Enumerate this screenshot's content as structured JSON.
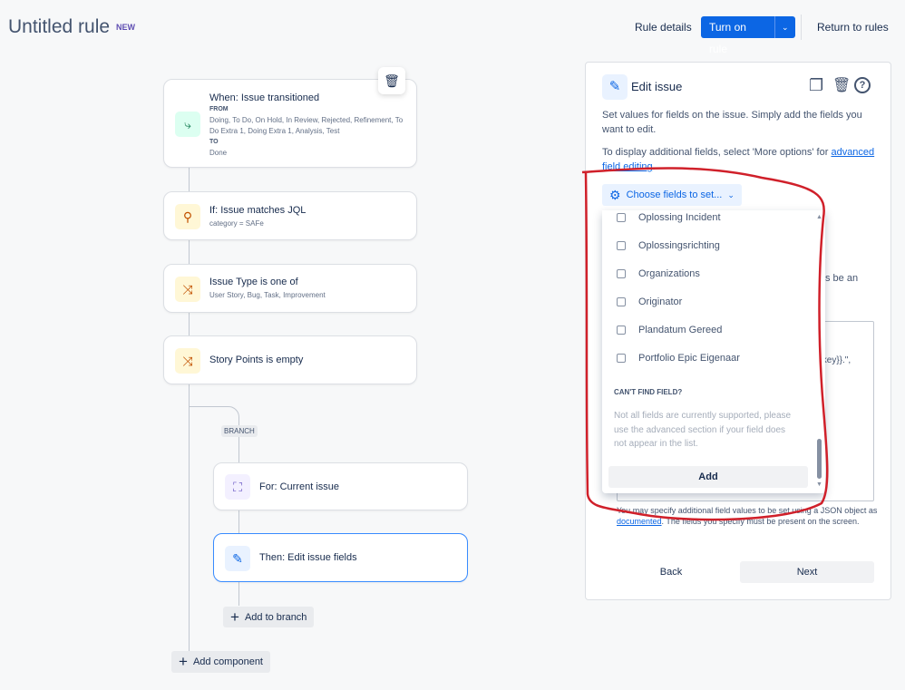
{
  "header": {
    "title": "Untitled rule",
    "badge": "NEW",
    "rule_details": "Rule details",
    "turn_on": "Turn on rule",
    "return": "Return to rules"
  },
  "flow": {
    "trigger": {
      "title": "When: Issue transitioned",
      "from_label": "FROM",
      "from": "Doing, To Do, On Hold, In Review, Rejected, Refinement, To Do Extra 1, Doing Extra 1, Analysis, Test",
      "to_label": "TO",
      "to": "Done"
    },
    "condition1": {
      "title": "If: Issue matches JQL",
      "sub": "category = SAFe"
    },
    "condition2": {
      "title": "Issue Type is one of",
      "sub": "User Story, Bug, Task, Improvement"
    },
    "condition3": {
      "title": "Story Points is empty"
    },
    "branch_label": "BRANCH",
    "branch": {
      "title": "For: Current issue"
    },
    "action": {
      "title": "Then: Edit issue fields"
    },
    "add_to_branch": "Add to branch",
    "add_component": "Add component"
  },
  "panel": {
    "title": "Edit issue",
    "desc1": "Set values for fields on the issue. Simply add the fields you want to edit.",
    "desc2": "To display additional fields, select 'More options' for ",
    "desc2_link": "advanced field editing",
    "desc2_end": ".",
    "choose": "Choose fields to set...",
    "hidden_text1": "s be an",
    "hidden_text2": ".key}}.\",",
    "footer_text1": "You may specify additional field values to be set using a JSON object as ",
    "footer_link": "documented",
    "footer_text2": ". The fields you specify must be present on the screen.",
    "back": "Back",
    "next": "Next"
  },
  "dropdown": {
    "options": [
      "Oplossing Incident",
      "Oplossingsrichting",
      "Organizations",
      "Originator",
      "Plandatum Gereed",
      "Portfolio Epic Eigenaar"
    ],
    "cant_find": "CAN'T FIND FIELD?",
    "cant_find_text": "Not all fields are currently supported, please use the advanced section if your field does not appear in the list.",
    "add": "Add"
  },
  "colors": {
    "primary": "#0c66e4",
    "annotation": "#d0202a"
  }
}
